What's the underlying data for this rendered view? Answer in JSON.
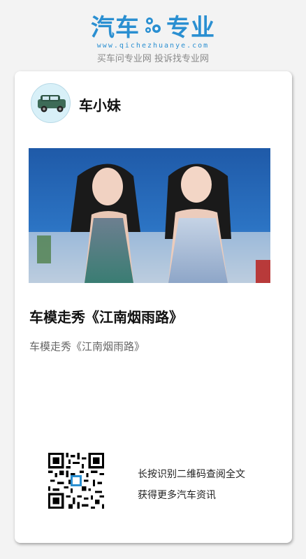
{
  "brand": {
    "name_left": "汽车",
    "name_right": "专业",
    "url": "www.qichezhuanye.com",
    "slogan": "买车问专业网 投诉找专业网",
    "color": "#2a8fd1"
  },
  "author": {
    "name": "车小妹",
    "avatar_icon": "car-icon"
  },
  "post": {
    "title": "车模走秀《江南烟雨路》",
    "summary": "车模走秀《江南烟雨路》"
  },
  "qr": {
    "line1": "长按识别二维码查阅全文",
    "line2": "获得更多汽车资讯"
  }
}
